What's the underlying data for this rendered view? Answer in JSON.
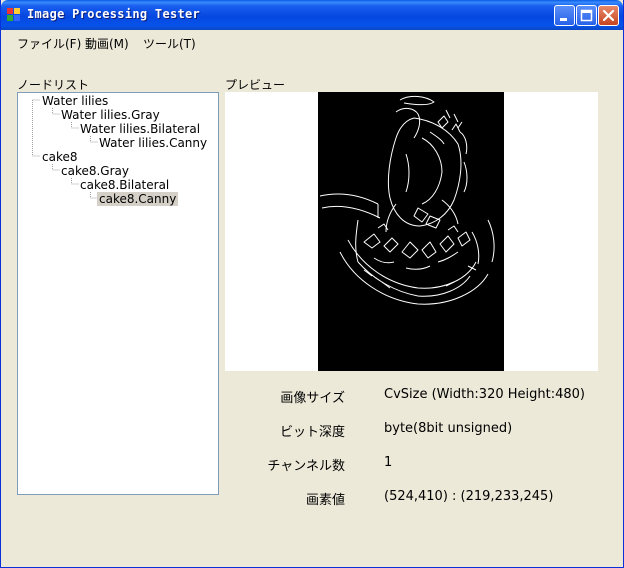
{
  "window": {
    "title": "Image Processing Tester"
  },
  "menu": {
    "items": [
      {
        "label": "ファイル(F)"
      },
      {
        "label": "動画(M)"
      },
      {
        "label": "ツール(T)"
      }
    ]
  },
  "tree": {
    "label": "ノードリスト",
    "nodes": [
      {
        "label": "Water lilies",
        "level": 0
      },
      {
        "label": "Water lilies.Gray",
        "level": 1
      },
      {
        "label": "Water lilies.Bilateral",
        "level": 2
      },
      {
        "label": "Water lilies.Canny",
        "level": 3
      },
      {
        "label": "cake8",
        "level": 0
      },
      {
        "label": "cake8.Gray",
        "level": 1
      },
      {
        "label": "cake8.Bilateral",
        "level": 2
      },
      {
        "label": "cake8.Canny",
        "level": 3,
        "selected": true
      }
    ]
  },
  "preview": {
    "label": "プレビュー"
  },
  "properties": [
    {
      "label": "画像サイズ",
      "value": "CvSize (Width:320 Height:480)"
    },
    {
      "label": "ビット深度",
      "value": "byte(8bit unsigned)"
    },
    {
      "label": "チャンネル数",
      "value": "1"
    },
    {
      "label": "画素値",
      "value": "(524,410) : (219,233,245)"
    }
  ],
  "colors": {
    "titlebar": "#0553e4",
    "window_bg": "#ece9d8",
    "close_button": "#c7441f",
    "selection": "#d4d0c8"
  }
}
